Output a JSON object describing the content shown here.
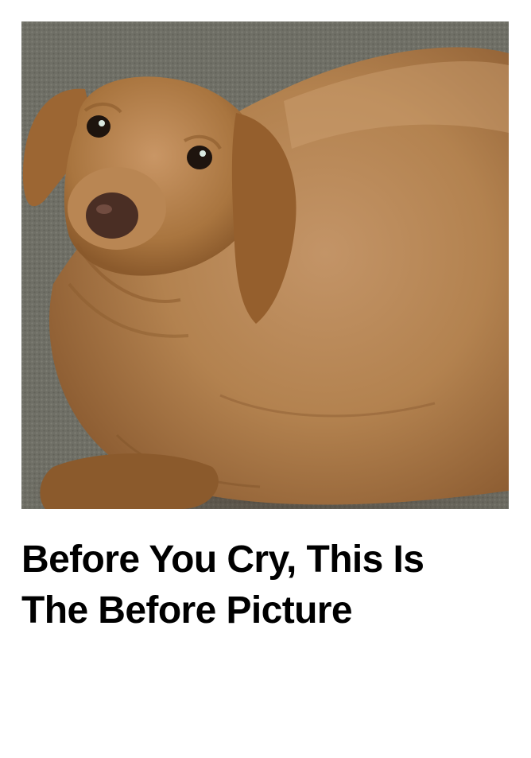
{
  "article": {
    "image": {
      "subject": "dachshund-photo",
      "colors": {
        "carpet": "#707066",
        "fur_light": "#b98a55",
        "fur_dark": "#8a5a2c",
        "nose": "#4a2e24"
      }
    },
    "headline": "Before You Cry, This Is The Before Picture"
  }
}
